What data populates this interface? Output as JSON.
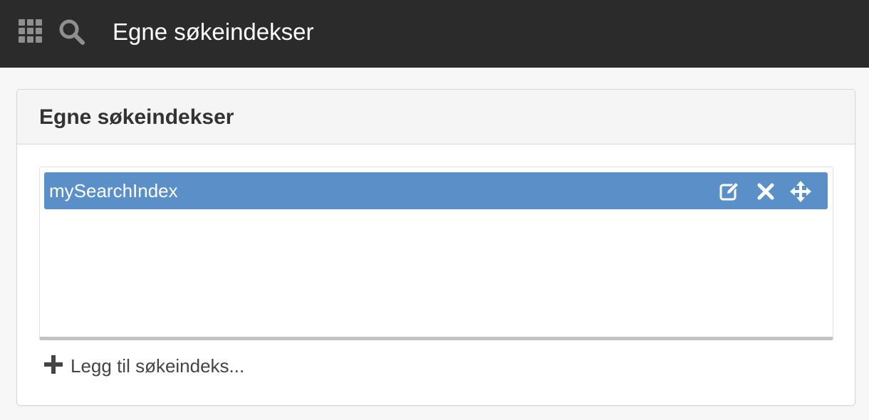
{
  "topbar": {
    "apps_icon": "grid-icon",
    "search_icon": "search-icon",
    "title": "Egne søkeindekser",
    "background": "#2b2b2b"
  },
  "panel": {
    "title": "Egne søkeindekser",
    "items": [
      {
        "label": "mySearchIndex",
        "selected": true,
        "actions": [
          "edit-icon",
          "close-icon",
          "move-icon"
        ]
      }
    ],
    "add_label": "Legg til søkeindeks...",
    "add_icon": "plus-icon"
  },
  "colors": {
    "accent": "#5a8fc7",
    "header_bg": "#2b2b2b",
    "panel_header_bg": "#f5f5f5"
  }
}
